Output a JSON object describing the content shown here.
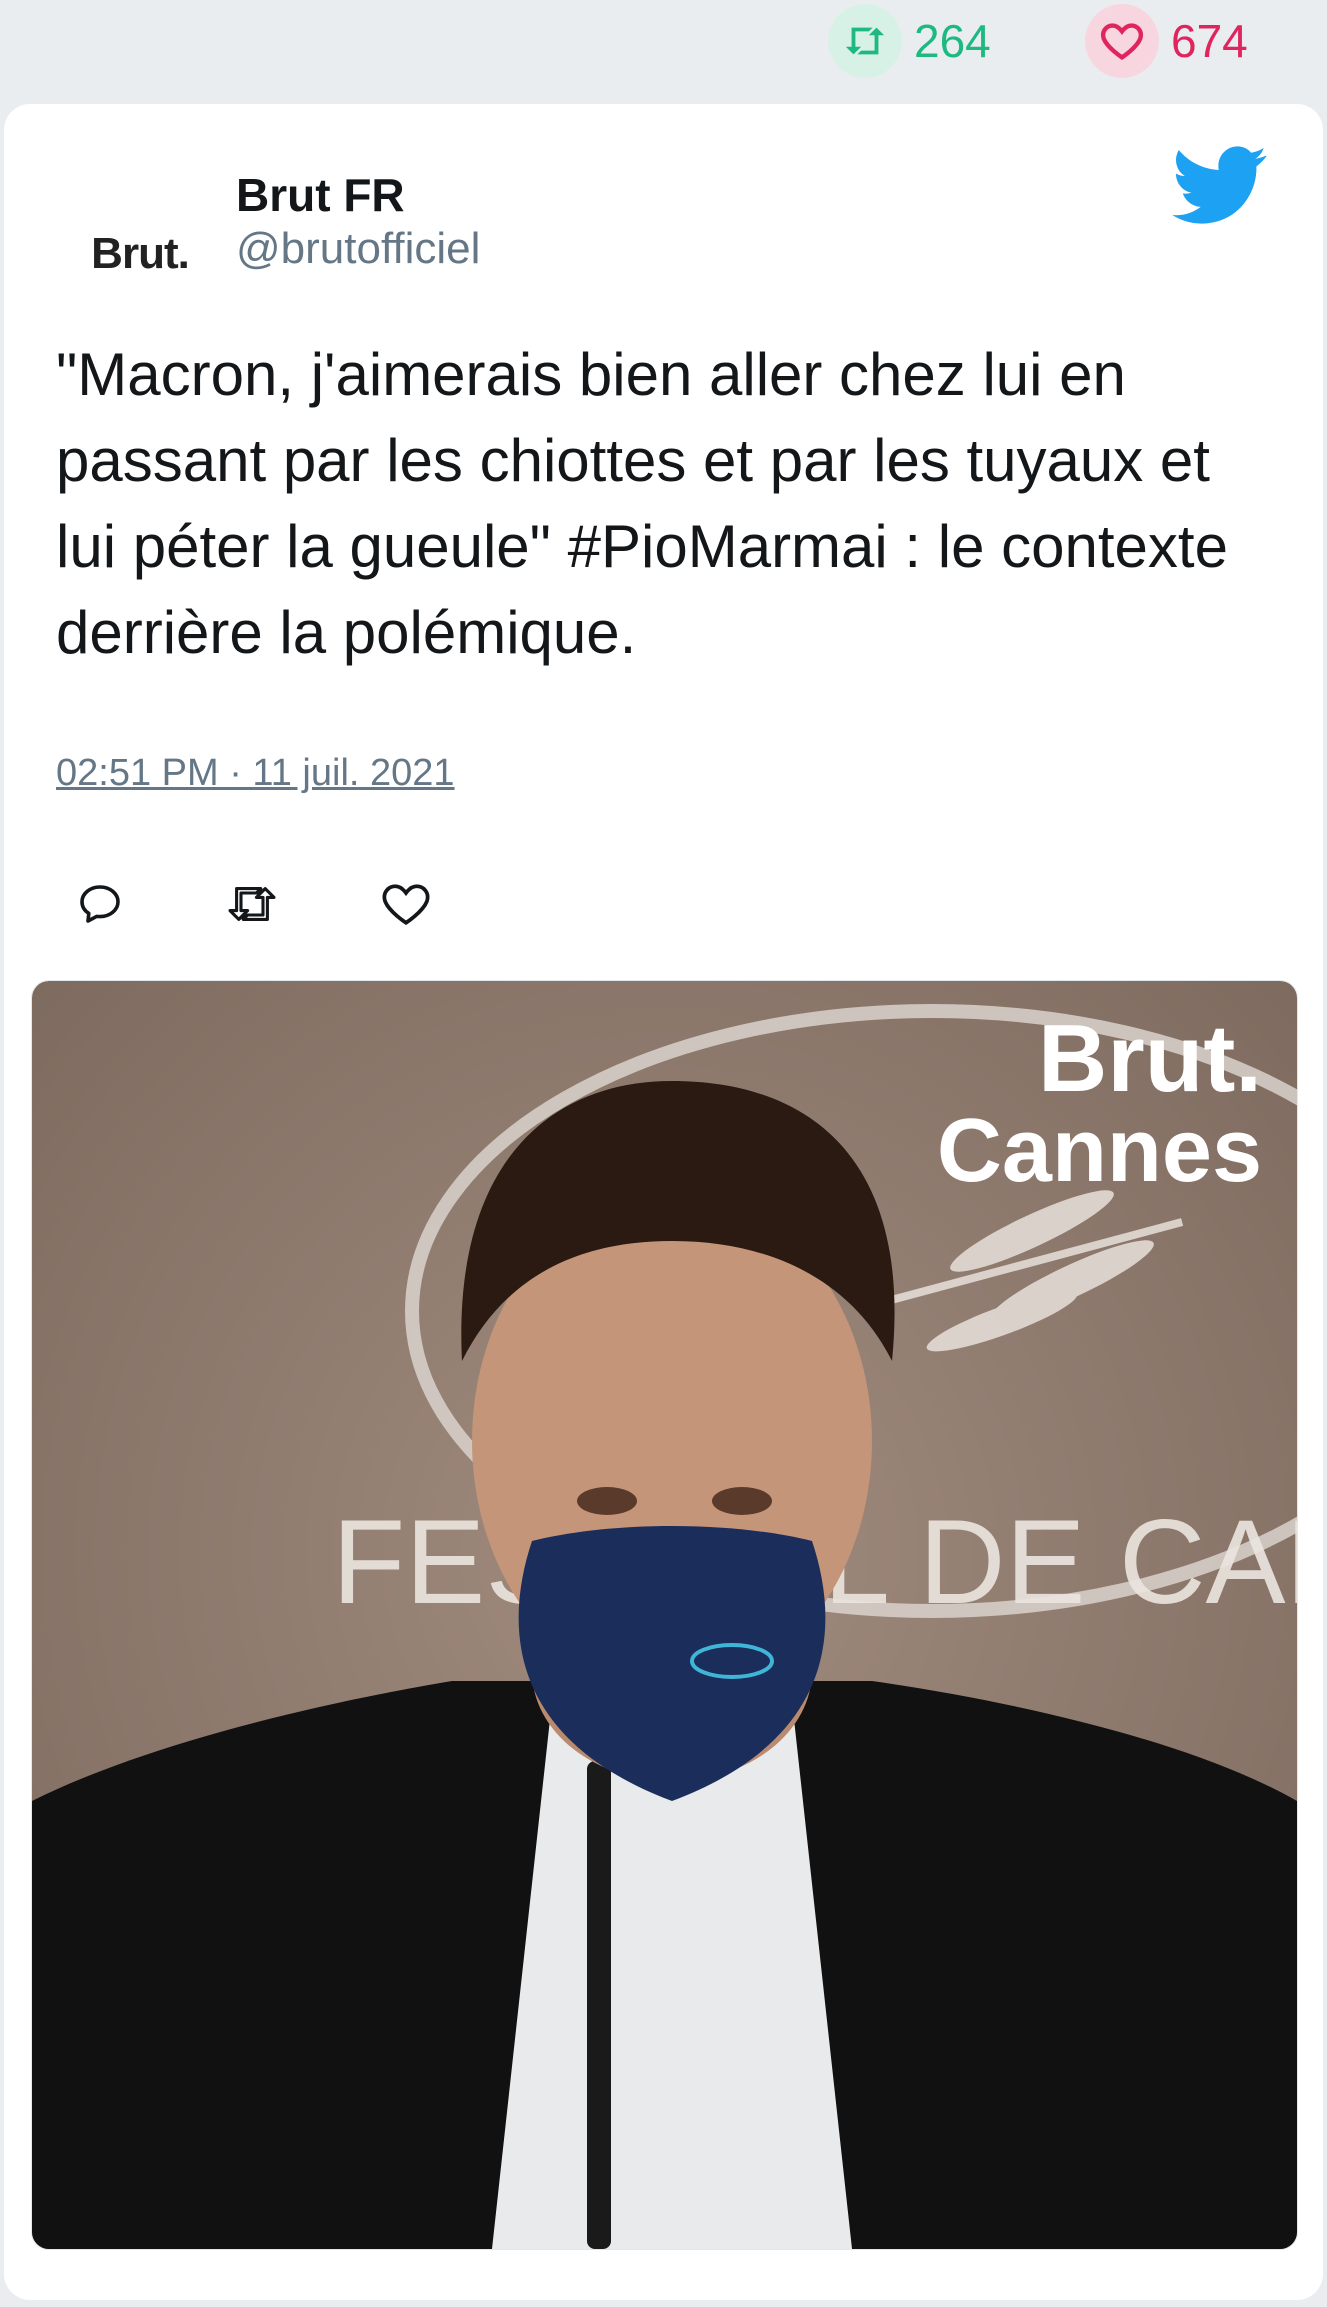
{
  "stats": {
    "retweet_icon": "retweet-icon",
    "retweet_count": "264",
    "like_icon": "heart-icon",
    "like_count": "674"
  },
  "tweet": {
    "author_name": "Brut FR",
    "author_handle": "@brutofficiel",
    "avatar_text": "Brut.",
    "text": "\"Macron, j'aimerais bien aller chez lui en passant par les chiottes et par les tuyaux et lui péter la gueule\" #PioMarmai : le contexte derrière la polémique.",
    "timestamp": "02:51 PM · 11 juil. 2021"
  },
  "media": {
    "overlay_brand": "Brut.",
    "overlay_event": "Cannes",
    "background_text": "FESTIVAL DE CANNES",
    "mask_color": "#1b2d5a",
    "backdrop_color": "#8f7a6d"
  },
  "colors": {
    "retweet_green": "#1eb980",
    "like_red": "#e0245e",
    "twitter_blue": "#1da1f2",
    "muted": "#657786"
  }
}
